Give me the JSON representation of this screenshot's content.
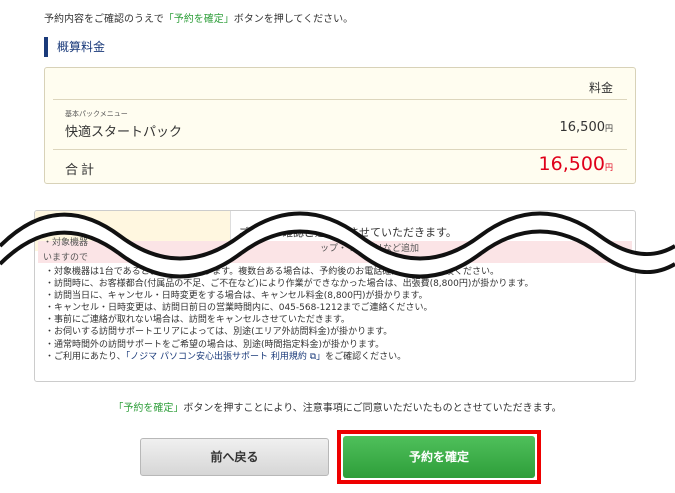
{
  "intro": {
    "before": "予約内容をご確認のうえで",
    "highlight": "「予約を確定」",
    "after": "ボタンを押してください。"
  },
  "fee": {
    "heading": "概算料金",
    "column_header": "料金",
    "menu_small_label": "基本パックメニュー",
    "menu_name": "快適スタートパック",
    "menu_price": "16,500",
    "menu_price_unit": "円",
    "total_label": "合計",
    "total_value": "16,500",
    "total_unit": "円"
  },
  "notes": {
    "head_right": "ご予約〜確認ご連絡をさせていただきます。",
    "pink_line1": "・対象機器",
    "pink_line2": "いますので",
    "pink_right": "ップ・リカバリなど追加",
    "items": [
      "・対象機器は1台であるとお伺いしております。複数台ある場合は、予約後のお電話確認の際にご相談ください。",
      "・訪問時に、お客様都合(付属品の不足、ご不在など)により作業ができなかった場合は、出張費(8,800円)が掛かります。",
      "・訪問当日に、キャンセル・日時変更をする場合は、キャンセル料金(8,800円)が掛かります。",
      "・キャンセル・日時変更は、訪問日前日の営業時間内に、045-568-1212までご連絡ください。",
      "・事前にご連絡が取れない場合は、訪問をキャンセルさせていただきます。",
      "・お伺いする訪問サポートエリアによっては、別途(エリア外訪問料金)が掛かります。",
      "・通常時間外の訪問サポートをご希望の場合は、別途(時間指定料金)が掛かります。"
    ],
    "link_item_prefix": "・ご利用にあたり、",
    "link_item_link": "「ノジマ パソコン安心出張サポート 利用規約 ⧉」",
    "link_item_suffix": "をご確認ください。"
  },
  "agree": {
    "highlight": "「予約を確定」",
    "text": "ボタンを押すことにより、注意事項にご同意いただいたものとさせていただきます。"
  },
  "buttons": {
    "back": "前へ戻る",
    "confirm": "予約を確定"
  },
  "colors": {
    "accent_green": "#2e9e3a",
    "price_red": "#e0001a",
    "heading_navy": "#1a3a7a",
    "highlight_frame": "#ee0000"
  }
}
